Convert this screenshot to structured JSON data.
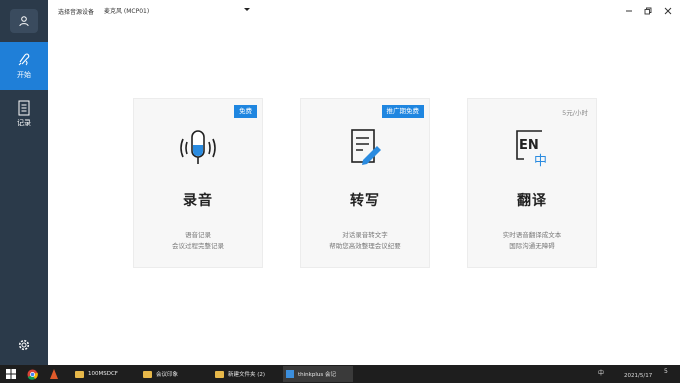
{
  "titlebar": {
    "device_label": "选择音源设备",
    "device_value": "麦克风 (MCP01)"
  },
  "sidebar": {
    "items": [
      {
        "label": "开始"
      },
      {
        "label": "记录"
      }
    ]
  },
  "cards": [
    {
      "badge": "免费",
      "title": "录音",
      "desc": [
        "语音记录",
        "会议过程完整记录"
      ]
    },
    {
      "badge": "推广期免费",
      "title": "转写",
      "desc": [
        "对话录音转文字",
        "帮助您高效整理会议纪要"
      ]
    },
    {
      "price": "5元/小时",
      "title": "翻译",
      "icon_text": "EN",
      "icon_sub": "中",
      "desc": [
        "实时语音翻译成文本",
        "国际沟通无障碍"
      ]
    }
  ],
  "taskbar": {
    "tasks": [
      "100MSDCF",
      "会议印象",
      "新建文件夹 (2)",
      "thinkplus 会记"
    ],
    "tray": {
      "ime": "中",
      "date": "2021/5/17",
      "notif_count": "5"
    }
  },
  "colors": {
    "sidebar": "#2b3a4a",
    "accent": "#1f7fd8",
    "badge": "#1f86e0"
  }
}
